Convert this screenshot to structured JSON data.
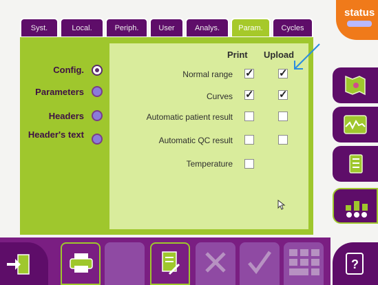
{
  "status": {
    "label": "status"
  },
  "tabs": [
    {
      "label": "Syst."
    },
    {
      "label": "Local."
    },
    {
      "label": "Periph."
    },
    {
      "label": "User"
    },
    {
      "label": "Analys."
    },
    {
      "label": "Param.",
      "active": true
    },
    {
      "label": "Cycles"
    }
  ],
  "sidebar": {
    "items": [
      {
        "label": "Config.",
        "selected": true
      },
      {
        "label": "Parameters"
      },
      {
        "label": "Headers"
      },
      {
        "label": "Header's text"
      }
    ]
  },
  "table": {
    "columns": [
      "Print",
      "Upload"
    ],
    "rows": [
      {
        "label": "Normal range",
        "print": true,
        "upload": true
      },
      {
        "label": "Curves",
        "print": true,
        "upload": true
      },
      {
        "label": "Automatic patient result",
        "print": false,
        "upload": false
      },
      {
        "label": "Automatic QC result",
        "print": false,
        "upload": false
      },
      {
        "label": "Temperature",
        "print": false,
        "upload": null
      }
    ]
  },
  "right_buttons": [
    "map-icon",
    "waveform-icon",
    "book-icon",
    "bar-chart-icon"
  ],
  "bottom_buttons": [
    "exit-icon",
    "printer-icon",
    "blank-button",
    "report-edit-icon",
    "cancel-icon",
    "confirm-icon",
    "keypad-icon",
    "help-icon"
  ],
  "colors": {
    "accent_green": "#9fc72d",
    "purple": "#5e0d69",
    "status_orange": "#f07a1a",
    "selected_tab": "#a6c92a"
  }
}
